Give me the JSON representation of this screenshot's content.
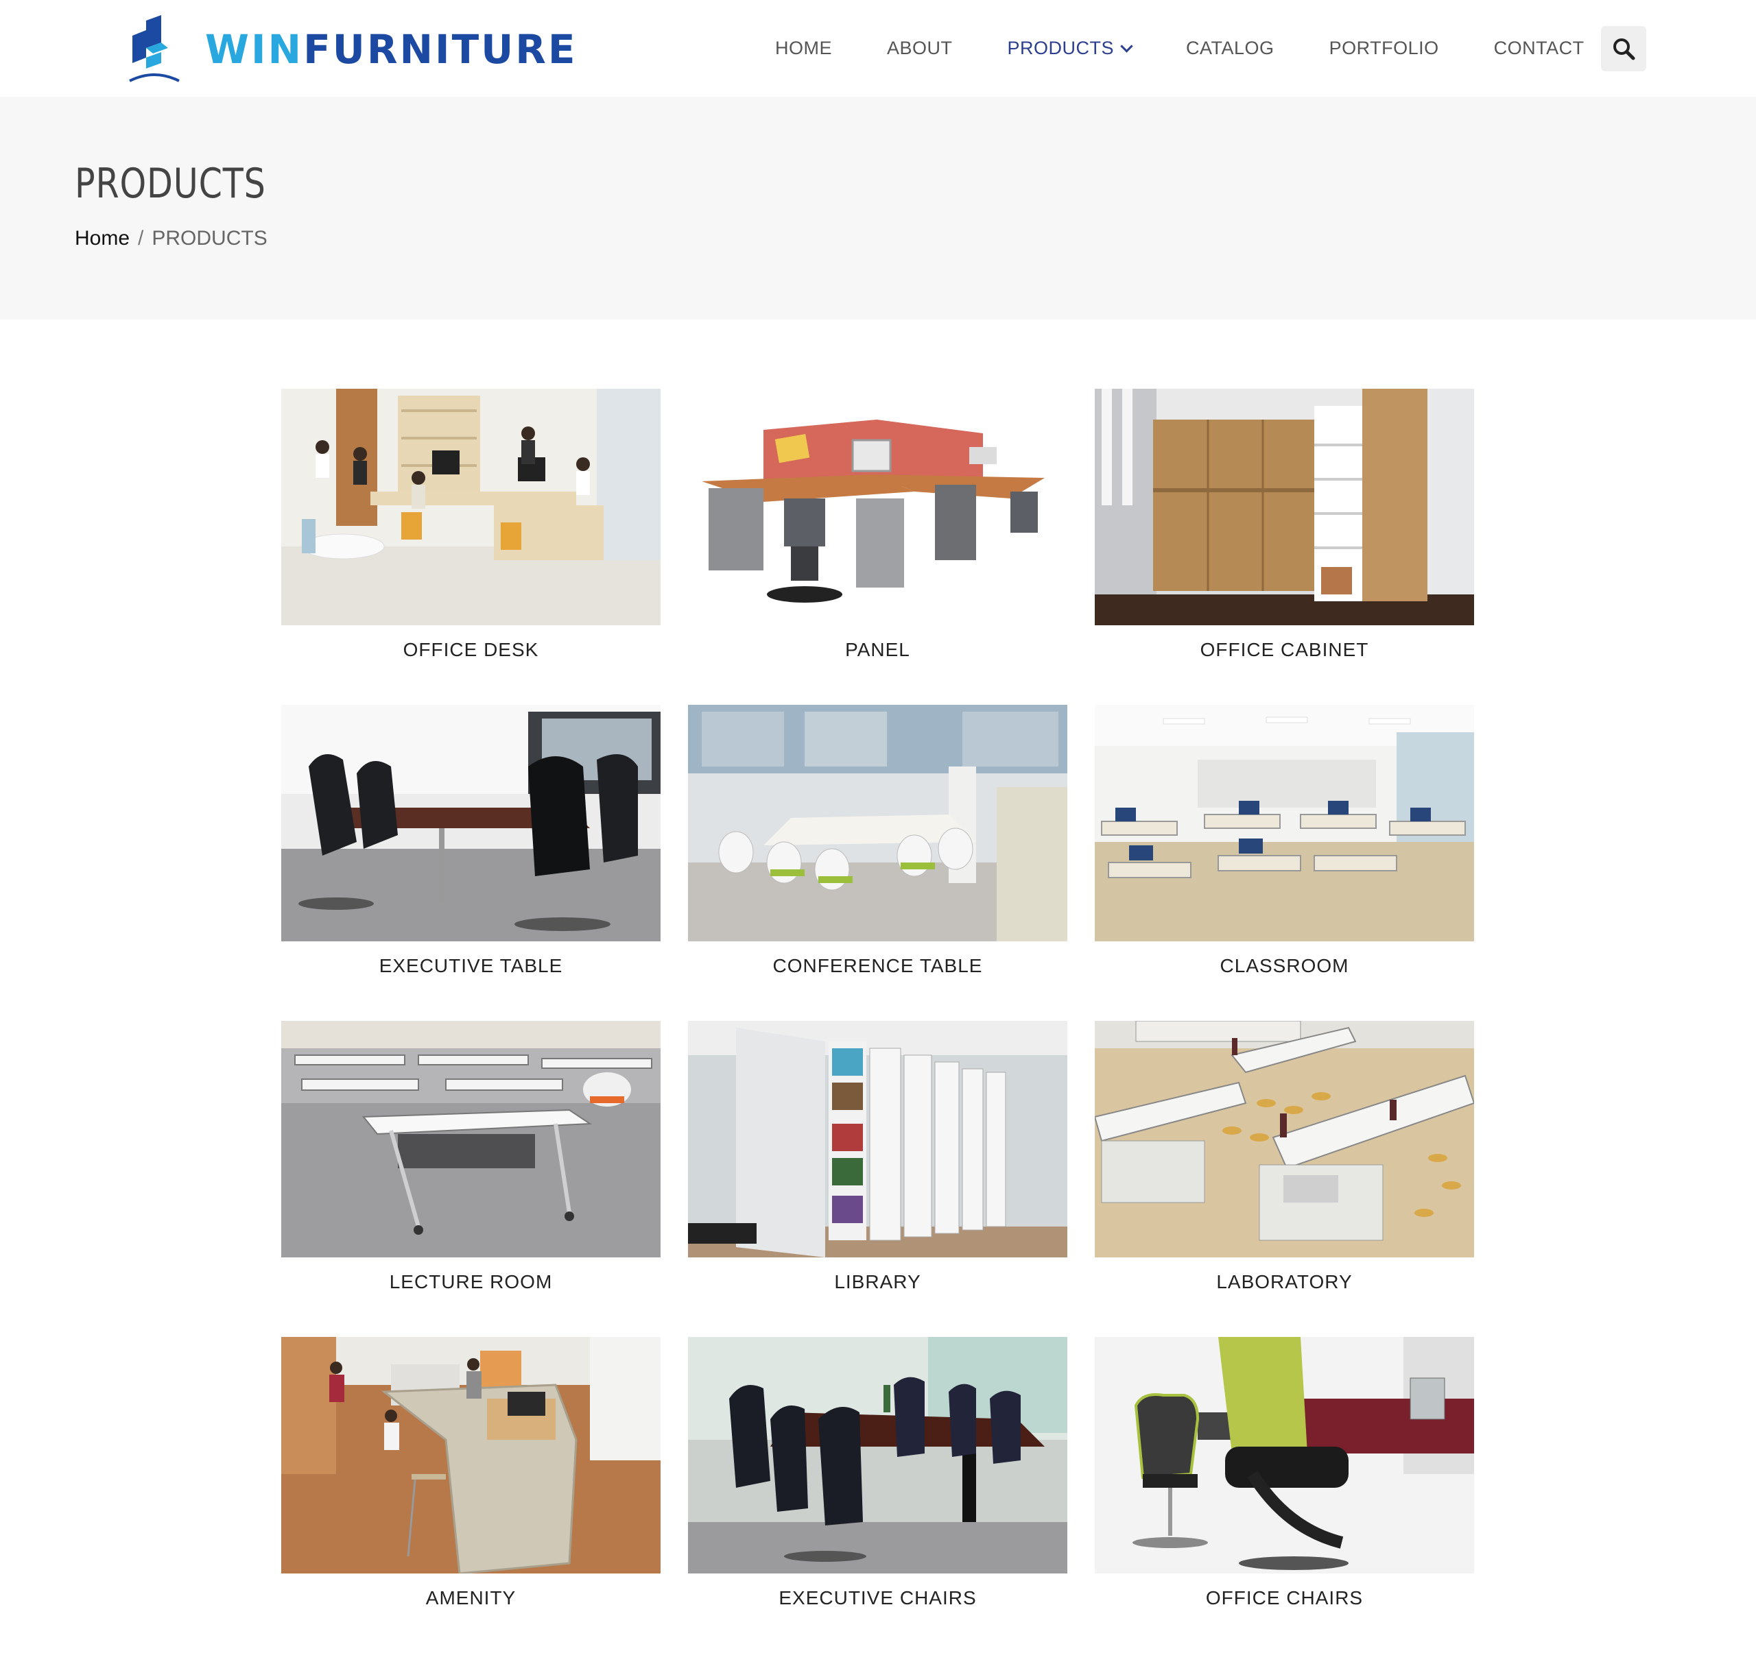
{
  "brand": {
    "logo_prefix": "WIN",
    "logo_suffix": "FURNITURE"
  },
  "nav": {
    "items": [
      {
        "label": "HOME",
        "active": false
      },
      {
        "label": "ABOUT",
        "active": false
      },
      {
        "label": "PRODUCTS",
        "active": true,
        "has_dropdown": true
      },
      {
        "label": "CATALOG",
        "active": false
      },
      {
        "label": "PORTFOLIO",
        "active": false
      },
      {
        "label": "CONTACT",
        "active": false
      }
    ],
    "search_icon": "search-icon"
  },
  "banner": {
    "title": "PRODUCTS",
    "breadcrumb": {
      "home": "Home",
      "separator": "/",
      "current": "PRODUCTS"
    }
  },
  "products": [
    {
      "label": "OFFICE DESK"
    },
    {
      "label": "PANEL"
    },
    {
      "label": "OFFICE CABINET"
    },
    {
      "label": "EXECUTIVE TABLE"
    },
    {
      "label": "CONFERENCE TABLE"
    },
    {
      "label": "CLASSROOM"
    },
    {
      "label": "LECTURE ROOM"
    },
    {
      "label": "LIBRARY"
    },
    {
      "label": "LABORATORY"
    },
    {
      "label": "AMENITY"
    },
    {
      "label": "EXECUTIVE CHAIRS"
    },
    {
      "label": "OFFICE CHAIRS"
    }
  ],
  "colors": {
    "brand_blue": "#1c4aa3",
    "brand_light_blue": "#29a8e0",
    "nav_active": "#2c3f8f",
    "banner_bg": "#f7f7f7"
  }
}
